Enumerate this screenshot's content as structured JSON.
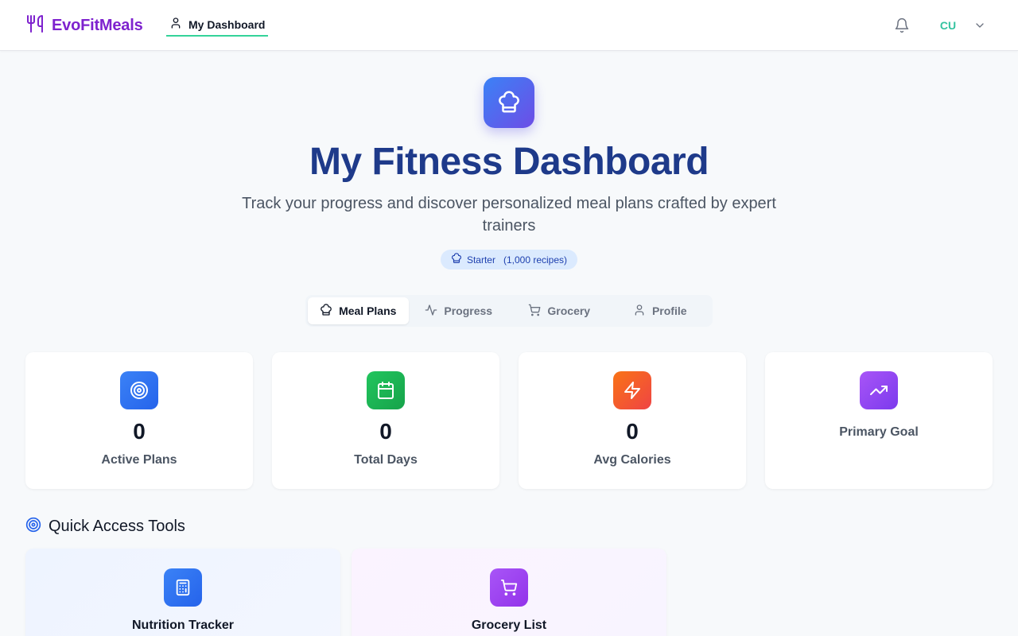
{
  "header": {
    "brand": "EvoFitMeals",
    "nav_link": "My Dashboard",
    "avatar_initials": "CU"
  },
  "hero": {
    "title": "My Fitness Dashboard",
    "subtitle": "Track your progress and discover personalized meal plans crafted by expert trainers",
    "plan_badge": {
      "tier": "Starter",
      "detail": "(1,000 recipes)"
    }
  },
  "tabs": [
    {
      "label": "Meal Plans",
      "icon": "chef-hat-icon",
      "active": true
    },
    {
      "label": "Progress",
      "icon": "activity-icon",
      "active": false
    },
    {
      "label": "Grocery",
      "icon": "cart-icon",
      "active": false
    },
    {
      "label": "Profile",
      "icon": "user-icon",
      "active": false
    }
  ],
  "stats": [
    {
      "value": "0",
      "label": "Active Plans",
      "icon": "target-icon",
      "color": "#2563eb"
    },
    {
      "value": "0",
      "label": "Total Days",
      "icon": "calendar-icon",
      "color": "#16a34a"
    },
    {
      "value": "0",
      "label": "Avg Calories",
      "icon": "zap-icon",
      "color": "#f97316"
    },
    {
      "label": "Primary Goal",
      "icon": "trending-up-icon",
      "color": "#9333ea"
    }
  ],
  "quick_access": {
    "heading": "Quick Access Tools",
    "tools": [
      {
        "label": "Nutrition Tracker",
        "icon": "calculator-icon",
        "color": "#2563eb"
      },
      {
        "label": "Grocery List",
        "icon": "cart-icon",
        "color": "#9333ea"
      }
    ]
  },
  "colors": {
    "brand": "#7e22ce",
    "title": "#1e3a8a",
    "active_underline": "#34d399",
    "avatar": "#34c3a0"
  }
}
